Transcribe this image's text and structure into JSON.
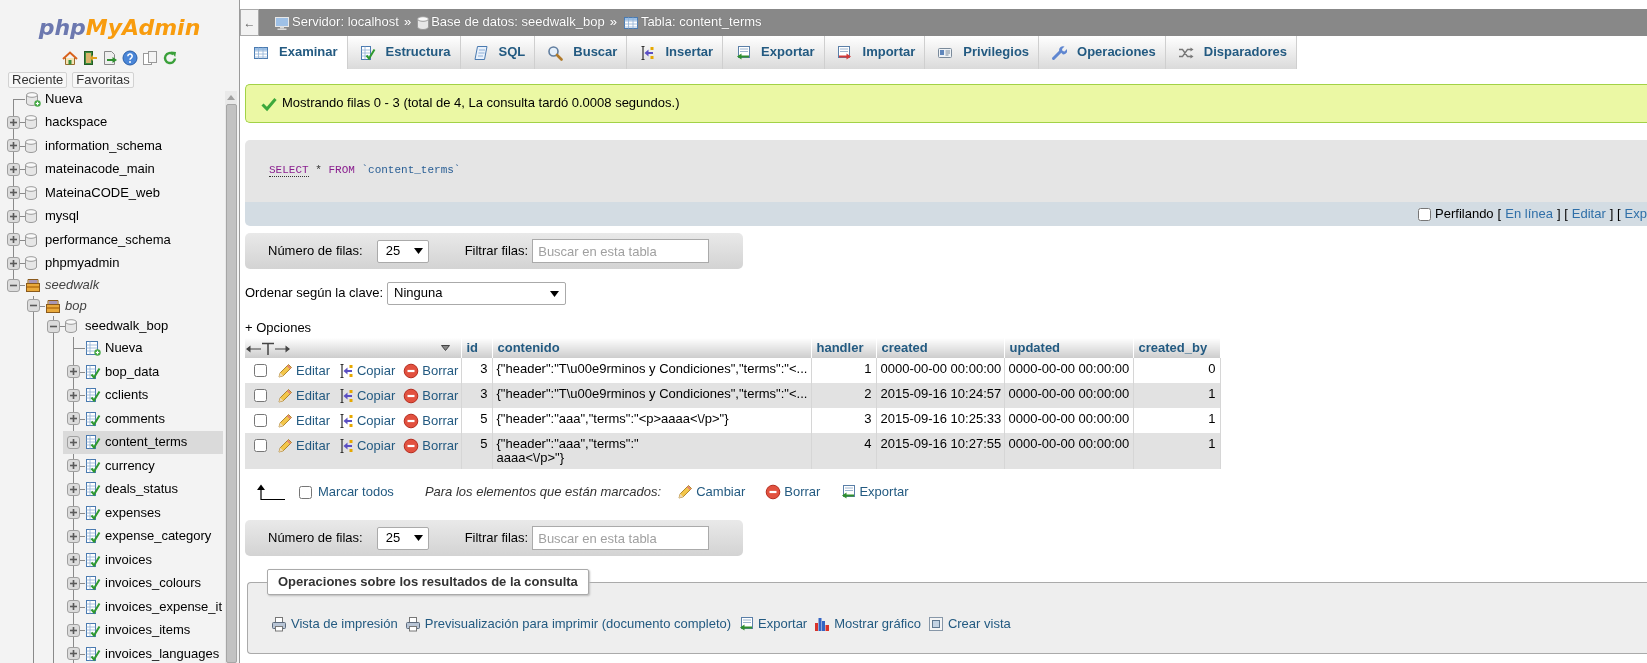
{
  "sidebar": {
    "logo": {
      "prefix": "php",
      "name": "MyAdmin"
    },
    "buttons": [
      "Reciente",
      "Favoritas"
    ],
    "tree": [
      {
        "kind": "new_database",
        "label": "Nueva",
        "selected": false
      },
      {
        "kind": "database",
        "label": "hackspace",
        "expanded": false,
        "selected": false
      },
      {
        "kind": "database",
        "label": "information_schema",
        "expanded": false,
        "selected": false
      },
      {
        "kind": "database",
        "label": "mateinacode_main",
        "expanded": false,
        "selected": false
      },
      {
        "kind": "database",
        "label": "MateinaCODE_web",
        "expanded": false,
        "selected": false
      },
      {
        "kind": "database",
        "label": "mysql",
        "expanded": false,
        "selected": false
      },
      {
        "kind": "database",
        "label": "performance_schema",
        "expanded": false,
        "selected": false
      },
      {
        "kind": "database",
        "label": "phpmyadmin",
        "expanded": false,
        "selected": false
      },
      {
        "kind": "group",
        "label": "seedwalk",
        "expanded": true,
        "selected": false,
        "children": [
          {
            "kind": "group",
            "label": "bop",
            "expanded": true,
            "selected": false,
            "children": [
              {
                "kind": "database",
                "label": "seedwalk_bop",
                "expanded": true,
                "selected": false,
                "children": [
                  {
                    "kind": "new_table",
                    "label": "Nueva",
                    "selected": false
                  },
                  {
                    "kind": "table",
                    "label": "bop_data",
                    "expanded": false,
                    "selected": false
                  },
                  {
                    "kind": "table",
                    "label": "cclients",
                    "expanded": false,
                    "selected": false
                  },
                  {
                    "kind": "table",
                    "label": "comments",
                    "expanded": false,
                    "selected": false
                  },
                  {
                    "kind": "table",
                    "label": "content_terms",
                    "expanded": false,
                    "selected": true
                  },
                  {
                    "kind": "table",
                    "label": "currency",
                    "expanded": false,
                    "selected": false
                  },
                  {
                    "kind": "table",
                    "label": "deals_status",
                    "expanded": false,
                    "selected": false
                  },
                  {
                    "kind": "table",
                    "label": "expenses",
                    "expanded": false,
                    "selected": false
                  },
                  {
                    "kind": "table",
                    "label": "expense_category",
                    "expanded": false,
                    "selected": false
                  },
                  {
                    "kind": "table",
                    "label": "invoices",
                    "expanded": false,
                    "selected": false
                  },
                  {
                    "kind": "table",
                    "label": "invoices_colours",
                    "expanded": false,
                    "selected": false
                  },
                  {
                    "kind": "table",
                    "label": "invoices_expense_it",
                    "expanded": false,
                    "selected": false
                  },
                  {
                    "kind": "table",
                    "label": "invoices_items",
                    "expanded": false,
                    "selected": false
                  },
                  {
                    "kind": "table",
                    "label": "invoices_languages",
                    "expanded": false,
                    "selected": false
                  }
                ]
              }
            ]
          }
        ]
      }
    ]
  },
  "header": {
    "toggle": "←",
    "breadcrumb": [
      {
        "text": "Servidor: localhost",
        "separator": "»"
      },
      {
        "text": "Base de datos: seedwalk_bop",
        "separator": "»"
      },
      {
        "text": "Tabla: content_terms"
      }
    ]
  },
  "tabs": [
    {
      "label": "Examinar",
      "selected": true
    },
    {
      "label": "Estructura",
      "selected": false
    },
    {
      "label": "SQL",
      "selected": false
    },
    {
      "label": "Buscar",
      "selected": false
    },
    {
      "label": "Insertar",
      "selected": false
    },
    {
      "label": "Exportar",
      "selected": false
    },
    {
      "label": "Importar",
      "selected": false
    },
    {
      "label": "Privilegios",
      "selected": false
    },
    {
      "label": "Operaciones",
      "selected": false
    },
    {
      "label": "Disparadores",
      "selected": false
    }
  ],
  "message": "Mostrando filas 0 - 3 (total de 4, La consulta tardó 0.0008 segundos.)",
  "sql": {
    "tokens": [
      {
        "kind": "keyword_link",
        "text": "SELECT"
      },
      {
        "kind": "operator",
        "text": "*"
      },
      {
        "kind": "keyword",
        "text": "FROM"
      },
      {
        "kind": "identifier",
        "text": "`content_terms`"
      }
    ]
  },
  "profiling": {
    "checked": false,
    "label": "Perfilando",
    "parts": [
      {
        "kind": "text",
        "text": "["
      },
      {
        "kind": "link",
        "text": "En línea"
      },
      {
        "kind": "text",
        "text": "] ["
      },
      {
        "kind": "link",
        "text": "Editar"
      },
      {
        "kind": "text",
        "text": "] ["
      },
      {
        "kind": "link",
        "text": "Exp"
      }
    ]
  },
  "nav_top": {
    "rows_label": "Número de filas:",
    "rows_value": "25",
    "filter": {
      "label": "Filtrar filas:",
      "placeholder": "Buscar en esta tabla"
    }
  },
  "sort": {
    "label": "Ordenar según la clave:",
    "value": "Ninguna"
  },
  "options_link": "+ Opciones",
  "table": {
    "columns": [
      "id",
      "contenido",
      "handler",
      "created",
      "updated",
      "created_by"
    ],
    "rows": [
      {
        "checked": false,
        "actions": [
          "Editar",
          "Copiar",
          "Borrar"
        ],
        "cells": [
          "3",
          "{\"header\":\"T\\u00e9rminos y Condiciones\",\"terms\":\"<...",
          "1",
          "0000-00-00 00:00:00",
          "0000-00-00 00:00:00",
          "0"
        ]
      },
      {
        "checked": false,
        "actions": [
          "Editar",
          "Copiar",
          "Borrar"
        ],
        "cells": [
          "3",
          "{\"header\":\"T\\u00e9rminos y Condiciones\",\"terms\":\"<...",
          "2",
          "2015-09-16 10:24:57",
          "0000-00-00 00:00:00",
          "1"
        ]
      },
      {
        "checked": false,
        "actions": [
          "Editar",
          "Copiar",
          "Borrar"
        ],
        "cells": [
          "5",
          "{\"header\":\"aaa\",\"terms\":\"<p>aaaa<\\/p>\"}",
          "3",
          "2015-09-16 10:25:33",
          "0000-00-00 00:00:00",
          "1"
        ]
      },
      {
        "checked": false,
        "actions": [
          "Editar",
          "Copiar",
          "Borrar"
        ],
        "cells": [
          "5",
          "{\"header\":\"aaa\",\"terms\":\"\naaaa<\\/p>\"}",
          "4",
          "2015-09-16 10:27:55",
          "0000-00-00 00:00:00",
          "1"
        ]
      }
    ]
  },
  "bulk": {
    "check_all": {
      "label": "Marcar todos",
      "checked": false
    },
    "with_selected": "Para los elementos que están marcados:",
    "actions": [
      "Cambiar",
      "Borrar",
      "Exportar"
    ]
  },
  "nav_bottom": {
    "rows_label": "Número de filas:",
    "rows_value": "25",
    "filter": {
      "label": "Filtrar filas:",
      "placeholder": "Buscar en esta tabla"
    }
  },
  "operations": {
    "legend": "Operaciones sobre los resultados de la consulta",
    "links": [
      "Vista de impresión",
      "Previsualización para imprimir (documento completo)",
      "Exportar",
      "Mostrar gráfico",
      "Crear vista"
    ]
  }
}
